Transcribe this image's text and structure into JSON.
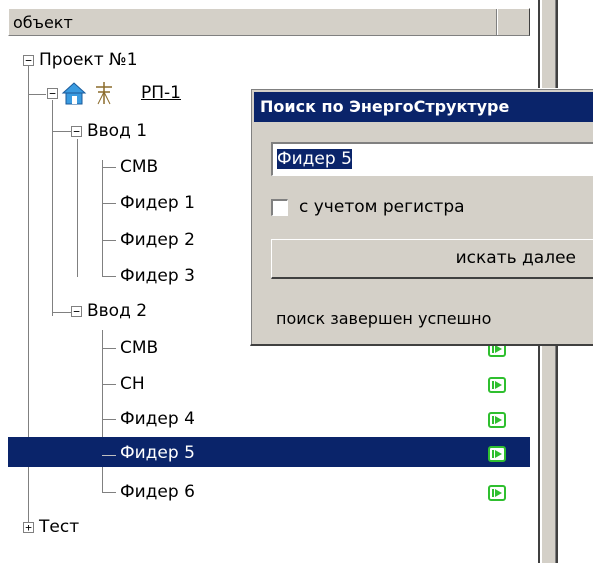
{
  "header": {
    "column_label": "объект"
  },
  "tree": {
    "project": {
      "label": "Проект №1",
      "expander": "−"
    },
    "rp": {
      "label": "РП-1",
      "expander": "−"
    },
    "input1": {
      "label": "Ввод 1",
      "expander": "−",
      "children": [
        "СМВ",
        "Фидер 1",
        "Фидер 2",
        "Фидер 3"
      ]
    },
    "input2": {
      "label": "Ввод 2",
      "expander": "−",
      "children": [
        "СМВ",
        "СН",
        "Фидер 4",
        "Фидер 5",
        "Фидер 6"
      ],
      "selected": "Фидер 5"
    },
    "test": {
      "label": "Тест",
      "expander": "+"
    }
  },
  "icons": {
    "rp": "house-and-transmission-tower-icon",
    "feeder_status": "green-play-icon",
    "expand": "plus-box-icon",
    "collapse": "minus-box-icon"
  },
  "colors": {
    "selection": "#0a246a",
    "status_green": "#2fbf2f",
    "window_bg": "#d4d0c8"
  },
  "dialog": {
    "title": "Поиск по ЭнергоСтруктуре",
    "search_value": "Фидер 5",
    "case_sensitive_label": "с учетом регистра",
    "case_sensitive_checked": false,
    "find_next_label": "искать далее",
    "status": "поиск завершен успешно"
  }
}
